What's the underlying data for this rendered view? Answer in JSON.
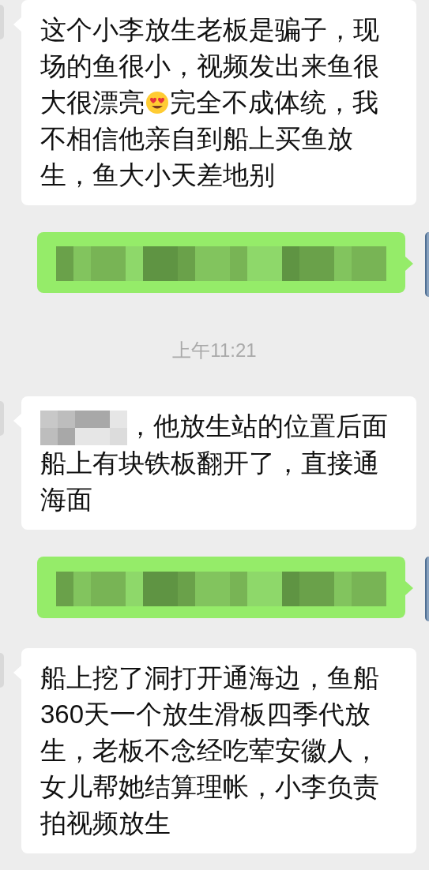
{
  "messages": [
    {
      "kind": "bubble",
      "outgoing": false,
      "parts": [
        {
          "kind": "text",
          "text": "这个小李放生老板是骗子，现场的鱼很小，视频发出来鱼很大很漂亮"
        },
        {
          "kind": "emoji"
        },
        {
          "kind": "text",
          "text": "完全不成体统，我不相信他亲自到船上买鱼放生，鱼大小天差地别"
        }
      ]
    },
    {
      "kind": "bubble",
      "outgoing": true,
      "parts": [
        {
          "kind": "pixelated"
        }
      ]
    },
    {
      "kind": "time",
      "text": "上午11:21"
    },
    {
      "kind": "bubble",
      "outgoing": false,
      "parts": [
        {
          "kind": "pixelated"
        },
        {
          "kind": "text",
          "text": "，他放生站的位置后面船上有块铁板翻开了，直接通海面"
        }
      ]
    },
    {
      "kind": "bubble",
      "outgoing": true,
      "parts": [
        {
          "kind": "pixelated"
        }
      ]
    },
    {
      "kind": "bubble",
      "outgoing": false,
      "parts": [
        {
          "kind": "text",
          "text": "船上挖了洞打开通海边，鱼船360天一个放生滑板四季代放生，老板不念经吃荤安徽人，女儿帮她结算理帐，小李负责拍视频放生"
        }
      ]
    }
  ]
}
